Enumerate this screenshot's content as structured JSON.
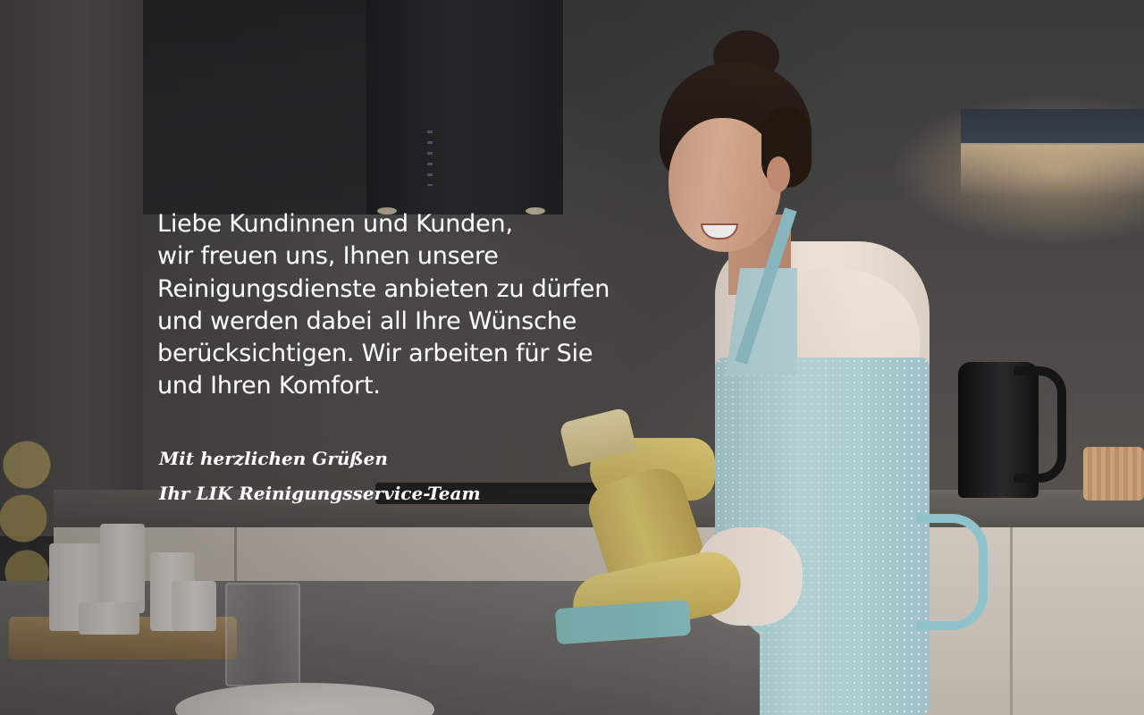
{
  "message": {
    "lines": [
      "Liebe Kundinnen und Kunden,",
      "wir freuen uns, Ihnen unsere",
      "Reinigungsdienste anbieten zu dürfen",
      "und werden dabei all Ihre Wünsche",
      "berücksichtigen. Wir arbeiten für Sie",
      "und Ihren Komfort."
    ]
  },
  "signature": {
    "greeting": "Mit herzlichen Grüßen",
    "team": "Ihr LIK Reinigungsservice-Team"
  },
  "colors": {
    "text": "#ffffff",
    "apron": "#a9cbd0",
    "gloves": "#e6d17a"
  }
}
